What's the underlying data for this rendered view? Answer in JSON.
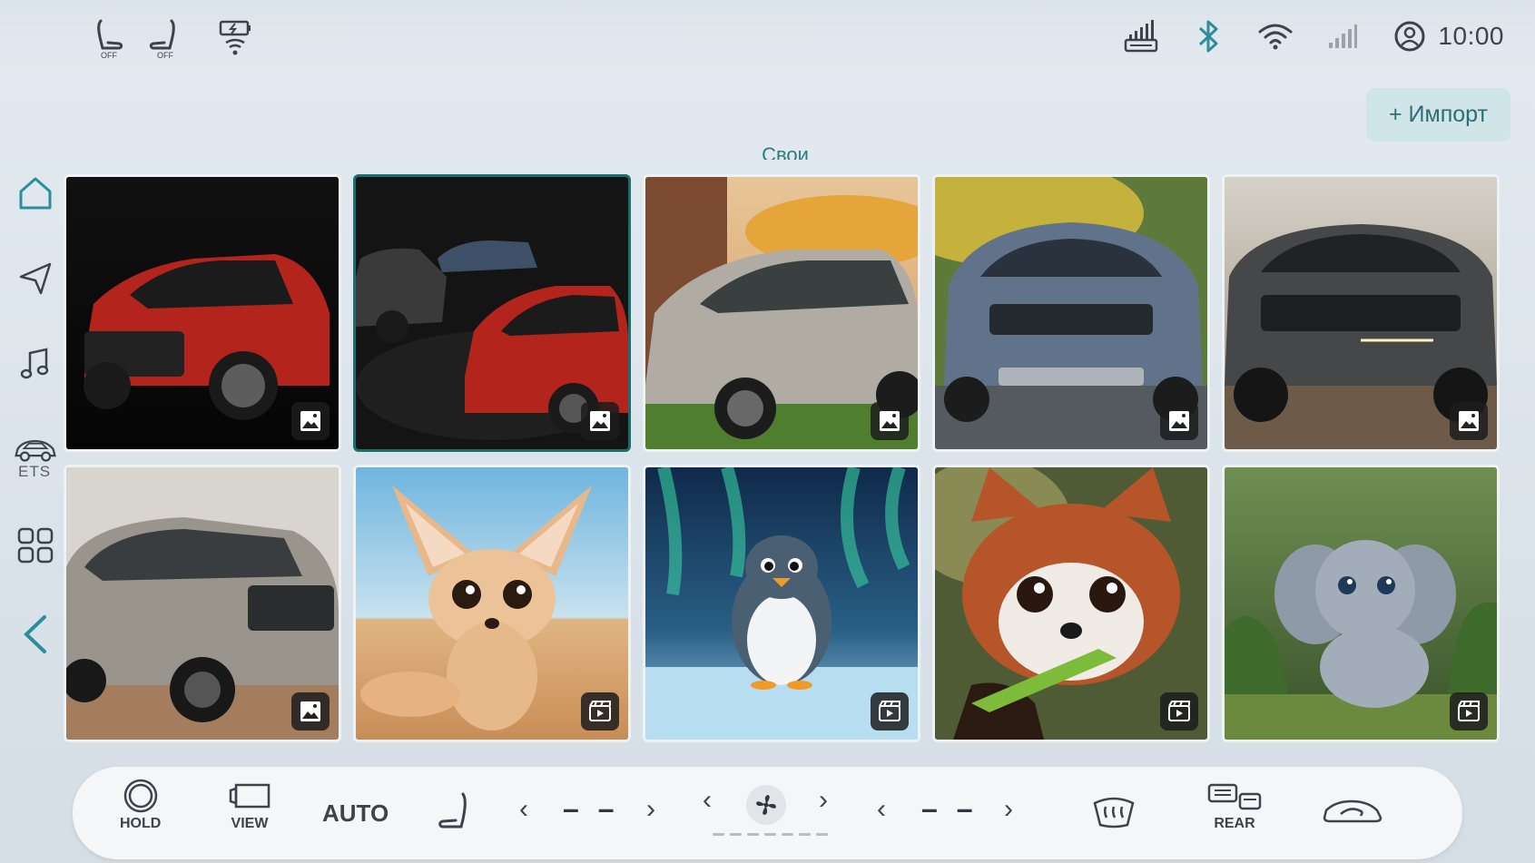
{
  "status_bar": {
    "left_icons": [
      "seat-heat-left-off-icon",
      "seat-heat-right-off-icon",
      "wireless-charging-icon"
    ],
    "seat_left_label": "OFF",
    "seat_right_label": "OFF",
    "right_icons": [
      "signal-tower-icon",
      "bluetooth-icon",
      "wifi-icon",
      "cellular-signal-icon",
      "user-avatar-icon"
    ],
    "time": "10:00"
  },
  "header": {
    "import_label": "+ Импорт",
    "section_title": "Свои"
  },
  "nav": {
    "items": [
      "home-icon",
      "navigation-icon",
      "music-icon",
      "ets-car-icon",
      "apps-grid-icon",
      "back-icon"
    ],
    "ets_label": "ETS"
  },
  "gallery": {
    "selected_index": 1,
    "tiles": [
      {
        "subject": "red-suv-dark",
        "media": "image"
      },
      {
        "subject": "three-suvs-dark",
        "media": "image"
      },
      {
        "subject": "silver-suv-autumn",
        "media": "image"
      },
      {
        "subject": "blue-suv-road",
        "media": "image"
      },
      {
        "subject": "grey-suv-dirt",
        "media": "image"
      },
      {
        "subject": "beige-suv-desert",
        "media": "image"
      },
      {
        "subject": "fennec-fox-desert",
        "media": "video"
      },
      {
        "subject": "penguin-aurora",
        "media": "video"
      },
      {
        "subject": "red-panda-bamboo",
        "media": "video"
      },
      {
        "subject": "baby-elephant-jungle",
        "media": "video"
      }
    ]
  },
  "climate": {
    "hold_label": "HOLD",
    "view_label": "VIEW",
    "auto_label": "AUTO",
    "left_temp": "– –",
    "right_temp": "– –",
    "rear_label": "REAR",
    "fan_level": 0
  },
  "colors": {
    "accent": "#1b6e6e",
    "import_bg": "#cfe5e8",
    "nav_accent": "#2a8f9a"
  }
}
